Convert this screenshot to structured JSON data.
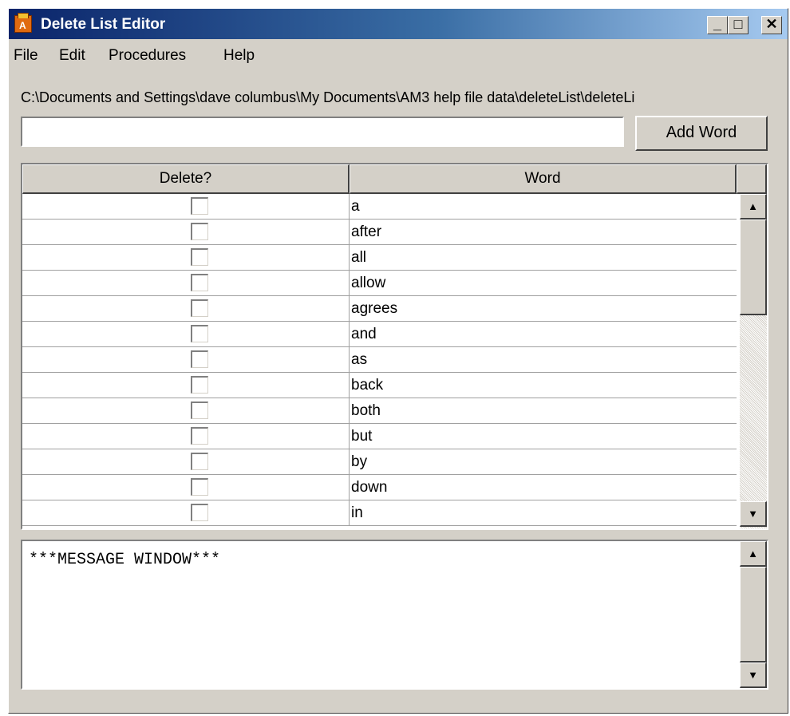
{
  "window": {
    "title": "Delete List Editor",
    "minimize": "_",
    "maximize": "□",
    "close": "✕"
  },
  "menu": [
    "File",
    "Edit",
    "Procedures",
    "Help"
  ],
  "file_path": "C:\\Documents and Settings\\dave columbus\\My Documents\\AM3 help file data\\deleteList\\deleteLi",
  "word_input": {
    "value": "",
    "placeholder": ""
  },
  "add_button": "Add Word",
  "table": {
    "headers": [
      "Delete?",
      "Word"
    ],
    "rows": [
      {
        "delete": false,
        "word": "a"
      },
      {
        "delete": false,
        "word": "after"
      },
      {
        "delete": false,
        "word": "all"
      },
      {
        "delete": false,
        "word": "allow"
      },
      {
        "delete": false,
        "word": "agrees"
      },
      {
        "delete": false,
        "word": "and"
      },
      {
        "delete": false,
        "word": "as"
      },
      {
        "delete": false,
        "word": "back"
      },
      {
        "delete": false,
        "word": "both"
      },
      {
        "delete": false,
        "word": "but"
      },
      {
        "delete": false,
        "word": "by"
      },
      {
        "delete": false,
        "word": "down"
      },
      {
        "delete": false,
        "word": "in"
      }
    ]
  },
  "message_window": "***MESSAGE WINDOW***",
  "icons": {
    "scroll_up": "▲",
    "scroll_down": "▼"
  }
}
